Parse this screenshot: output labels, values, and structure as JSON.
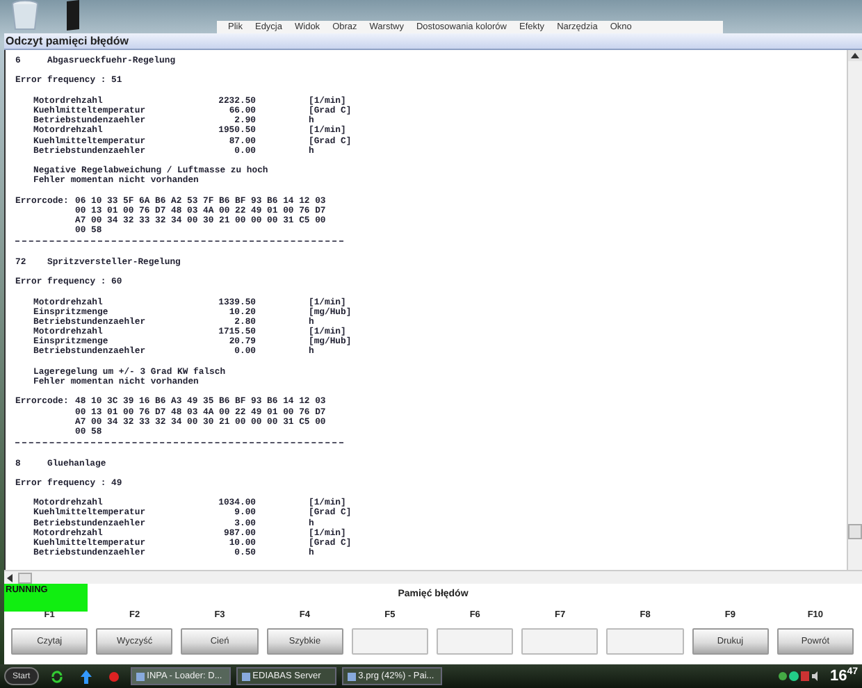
{
  "background_menu": [
    "Plik",
    "Edycja",
    "Widok",
    "Obraz",
    "Warstwy",
    "Dostosowania kolorów",
    "Efekty",
    "Narzędzia",
    "Okno"
  ],
  "window": {
    "title": "Odczyt pamięci błędów"
  },
  "report": [
    {
      "number": "6",
      "name": "Abgasrueckfuehr-Regelung",
      "frequency": "Error frequency : 51",
      "params": [
        {
          "name": "Motordrehzahl",
          "value": "2232.50",
          "unit": "[1/min]"
        },
        {
          "name": "Kuehlmitteltemperatur",
          "value": "66.00",
          "unit": "[Grad C]"
        },
        {
          "name": "Betriebstundenzaehler",
          "value": "2.90",
          "unit": "h"
        },
        {
          "name": "Motordrehzahl",
          "value": "1950.50",
          "unit": "[1/min]"
        },
        {
          "name": "Kuehlmitteltemperatur",
          "value": "87.00",
          "unit": "[Grad C]"
        },
        {
          "name": "Betriebstundenzaehler",
          "value": "0.00",
          "unit": "h"
        }
      ],
      "messages": [
        "Negative Regelabweichung / Luftmasse zu hoch",
        "Fehler momentan nicht vorhanden"
      ],
      "errorcode_label": "Errorcode:",
      "errorcode": [
        "06 10 33 5F 6A B6 A2 53 7F B6 BF 93 B6 14 12 03",
        "00 13 01 00 76 D7 48 03 4A 00 22 49 01 00 76 D7",
        "A7 00 34 32 33 32 34 00 30 21 00 00 00 31 C5 00",
        "00 58"
      ]
    },
    {
      "number": "72",
      "name": "Spritzversteller-Regelung",
      "frequency": "Error frequency : 60",
      "params": [
        {
          "name": "Motordrehzahl",
          "value": "1339.50",
          "unit": "[1/min]"
        },
        {
          "name": "Einspritzmenge",
          "value": "10.20",
          "unit": "[mg/Hub]"
        },
        {
          "name": "Betriebstundenzaehler",
          "value": "2.80",
          "unit": "h"
        },
        {
          "name": "Motordrehzahl",
          "value": "1715.50",
          "unit": "[1/min]"
        },
        {
          "name": "Einspritzmenge",
          "value": "20.79",
          "unit": "[mg/Hub]"
        },
        {
          "name": "Betriebstundenzaehler",
          "value": "0.00",
          "unit": "h"
        }
      ],
      "messages": [
        "Lageregelung um +/- 3 Grad KW falsch",
        "Fehler momentan nicht vorhanden"
      ],
      "errorcode_label": "Errorcode:",
      "errorcode": [
        "48 10 3C 39 16 B6 A3 49 35 B6 BF 93 B6 14 12 03",
        "00 13 01 00 76 D7 48 03 4A 00 22 49 01 00 76 D7",
        "A7 00 34 32 33 32 34 00 30 21 00 00 00 31 C5 00",
        "00 58"
      ]
    },
    {
      "number": "8",
      "name": "Gluehanlage",
      "frequency": "Error frequency : 49",
      "params": [
        {
          "name": "Motordrehzahl",
          "value": "1034.00",
          "unit": "[1/min]"
        },
        {
          "name": "Kuehlmitteltemperatur",
          "value": "9.00",
          "unit": "[Grad C]"
        },
        {
          "name": "Betriebstundenzaehler",
          "value": "3.00",
          "unit": "h"
        },
        {
          "name": "Motordrehzahl",
          "value": "987.00",
          "unit": "[1/min]"
        },
        {
          "name": "Kuehlmitteltemperatur",
          "value": "10.00",
          "unit": "[Grad C]"
        },
        {
          "name": "Betriebstundenzaehler",
          "value": "0.50",
          "unit": "h"
        }
      ]
    }
  ],
  "status": {
    "text": "RUNNING",
    "running": true
  },
  "panel_title": "Pamięć błędów",
  "function_keys": [
    {
      "key": "F1",
      "label": "Czytaj",
      "enabled": true
    },
    {
      "key": "F2",
      "label": "Wyczyść",
      "enabled": true
    },
    {
      "key": "F3",
      "label": "Cień",
      "enabled": true
    },
    {
      "key": "F4",
      "label": "Szybkie",
      "enabled": true
    },
    {
      "key": "F5",
      "enabled": false
    },
    {
      "key": "F6",
      "enabled": false
    },
    {
      "key": "F7",
      "enabled": false
    },
    {
      "key": "F8",
      "enabled": false
    },
    {
      "key": "F9",
      "label": "Drukuj",
      "enabled": true
    },
    {
      "key": "F10",
      "label": "Powrót",
      "enabled": true
    }
  ],
  "taskbar": {
    "start": "Start",
    "tasks": [
      {
        "label": "INPA - Loader: D...",
        "selected": true
      },
      {
        "label": "EDIABAS Server",
        "selected": false
      },
      {
        "label": "3.prg (42%) - Pai...",
        "selected": false
      }
    ],
    "clock": "16$^{47}$"
  }
}
